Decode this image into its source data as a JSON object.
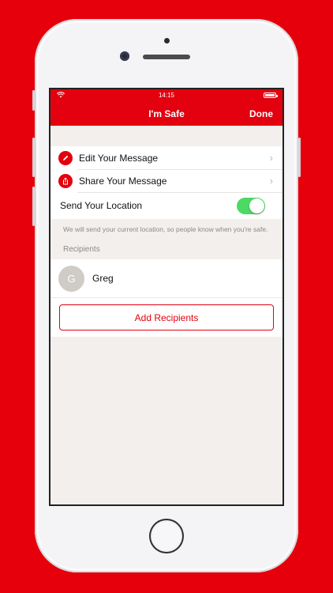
{
  "status_bar": {
    "time": "14:15",
    "wifi_icon": "wifi-icon",
    "battery_icon": "battery-icon"
  },
  "nav": {
    "title": "I'm Safe",
    "done_label": "Done"
  },
  "menu": {
    "items": [
      {
        "label": "Edit Your Message",
        "icon": "pencil-icon",
        "chevron": "›"
      },
      {
        "label": "Share Your Message",
        "icon": "share-icon",
        "chevron": "›"
      }
    ]
  },
  "location": {
    "label": "Send Your Location",
    "enabled": true,
    "note": "We will send your current location, so people know when you're safe."
  },
  "recipients": {
    "heading": "Recipients",
    "list": [
      {
        "initial": "G",
        "name": "Greg"
      }
    ],
    "add_label": "Add Recipients"
  },
  "colors": {
    "brand": "#e3000f",
    "toggle_on": "#4cd964",
    "background": "#e5000b"
  }
}
